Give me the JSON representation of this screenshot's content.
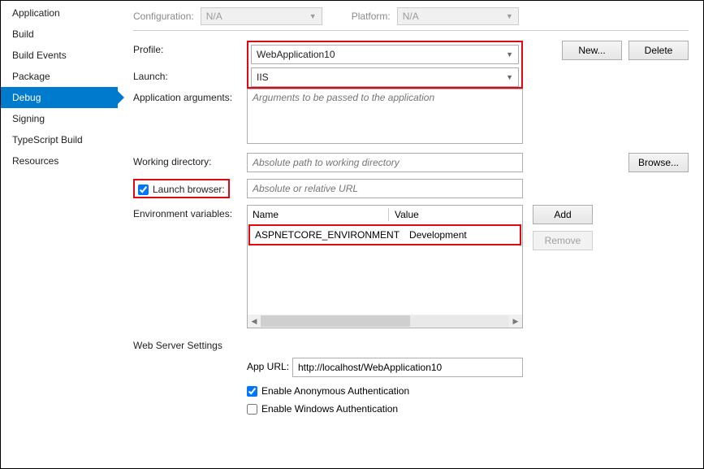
{
  "sidebar": {
    "items": [
      {
        "label": "Application"
      },
      {
        "label": "Build"
      },
      {
        "label": "Build Events"
      },
      {
        "label": "Package"
      },
      {
        "label": "Debug"
      },
      {
        "label": "Signing"
      },
      {
        "label": "TypeScript Build"
      },
      {
        "label": "Resources"
      }
    ]
  },
  "top": {
    "configuration_label": "Configuration:",
    "configuration_value": "N/A",
    "platform_label": "Platform:",
    "platform_value": "N/A"
  },
  "form": {
    "profile_label": "Profile:",
    "profile_value": "WebApplication10",
    "new_btn": "New...",
    "delete_btn": "Delete",
    "launch_label": "Launch:",
    "launch_value": "IIS",
    "app_args_label": "Application arguments:",
    "app_args_placeholder": "Arguments to be passed to the application",
    "workdir_label": "Working directory:",
    "workdir_placeholder": "Absolute path to working directory",
    "browse_btn": "Browse...",
    "launch_browser_label": "Launch browser:",
    "launch_browser_placeholder": "Absolute or relative URL",
    "launch_browser_checked": true,
    "env_label": "Environment variables:",
    "env_col_name": "Name",
    "env_col_value": "Value",
    "env_rows": [
      {
        "name": "ASPNETCORE_ENVIRONMENT",
        "value": "Development"
      }
    ],
    "add_btn": "Add",
    "remove_btn": "Remove",
    "web_settings_head": "Web Server Settings",
    "app_url_label": "App URL:",
    "app_url_value": "http://localhost/WebApplication10",
    "anon_auth_label": "Enable Anonymous Authentication",
    "anon_auth_checked": true,
    "win_auth_label": "Enable Windows Authentication",
    "win_auth_checked": false
  }
}
